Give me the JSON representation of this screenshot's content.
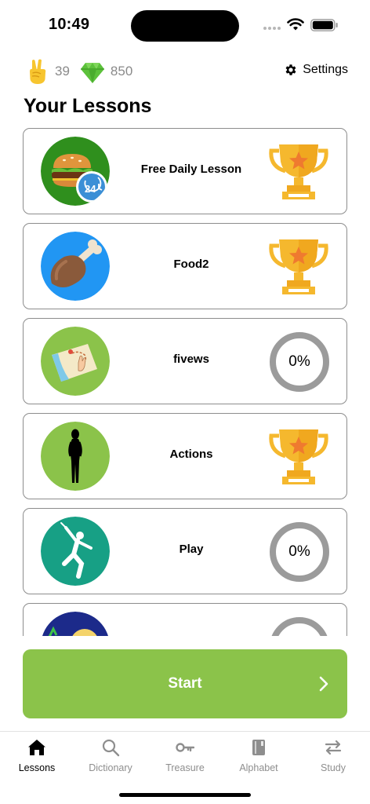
{
  "status_bar": {
    "time": "10:49"
  },
  "stats": {
    "streak": "39",
    "gems": "850"
  },
  "settings": {
    "label": "Settings"
  },
  "section_title": "Your Lessons",
  "lessons": [
    {
      "title": "Free Daily Lesson",
      "status": "trophy"
    },
    {
      "title": "Food2",
      "status": "trophy"
    },
    {
      "title": "fivews",
      "status": "progress",
      "progress_text": "0%"
    },
    {
      "title": "Actions",
      "status": "trophy"
    },
    {
      "title": "Play",
      "status": "progress",
      "progress_text": "0%"
    },
    {
      "title": "",
      "status": "progress",
      "progress_text": ""
    }
  ],
  "start_button": {
    "label": "Start"
  },
  "tabs": [
    {
      "label": "Lessons",
      "icon": "house-icon",
      "active": true
    },
    {
      "label": "Dictionary",
      "icon": "search-icon",
      "active": false
    },
    {
      "label": "Treasure",
      "icon": "key-icon",
      "active": false
    },
    {
      "label": "Alphabet",
      "icon": "book-icon",
      "active": false
    },
    {
      "label": "Study",
      "icon": "swap-arrows-icon",
      "active": false
    }
  ],
  "colors": {
    "accent_green": "#8bc34a",
    "trophy_gold": "#f5b82e",
    "ring_gray": "#9b9b9b",
    "gem_green": "#5cc13b"
  }
}
